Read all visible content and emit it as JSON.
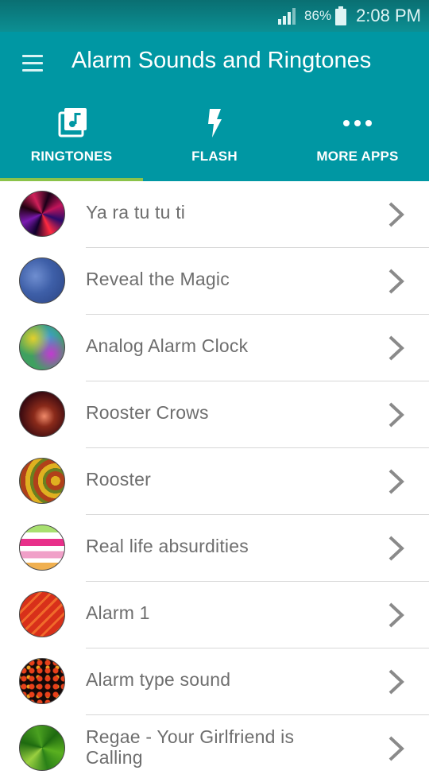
{
  "status_bar": {
    "battery_pct": "86%",
    "time": "2:08 PM",
    "signal_icon": "signal-icon",
    "battery_icon": "battery-icon"
  },
  "header": {
    "title": "Alarm Sounds and Ringtones",
    "menu_icon": "hamburger-menu-icon"
  },
  "tabs": [
    {
      "label": "RINGTONES",
      "icon": "music-library-icon",
      "selected": true
    },
    {
      "label": "FLASH",
      "icon": "flash-icon",
      "selected": false
    },
    {
      "label": "MORE APPS",
      "icon": "more-dots-icon",
      "selected": false
    }
  ],
  "ringtones": [
    {
      "title": "Ya ra tu tu ti"
    },
    {
      "title": "Reveal the Magic"
    },
    {
      "title": "Analog Alarm Clock"
    },
    {
      "title": "Rooster Crows"
    },
    {
      "title": "Rooster"
    },
    {
      "title": "Real life absurdities"
    },
    {
      "title": "Alarm 1"
    },
    {
      "title": "Alarm type sound"
    },
    {
      "title": "Regae - Your Girlfriend is Calling"
    }
  ],
  "colors": {
    "status_bar": "#0a6f72",
    "app_bar": "#0097a3",
    "tab_indicator": "#8bc34a",
    "item_text": "#6e6e6e",
    "chevron": "#8a8a8a"
  }
}
